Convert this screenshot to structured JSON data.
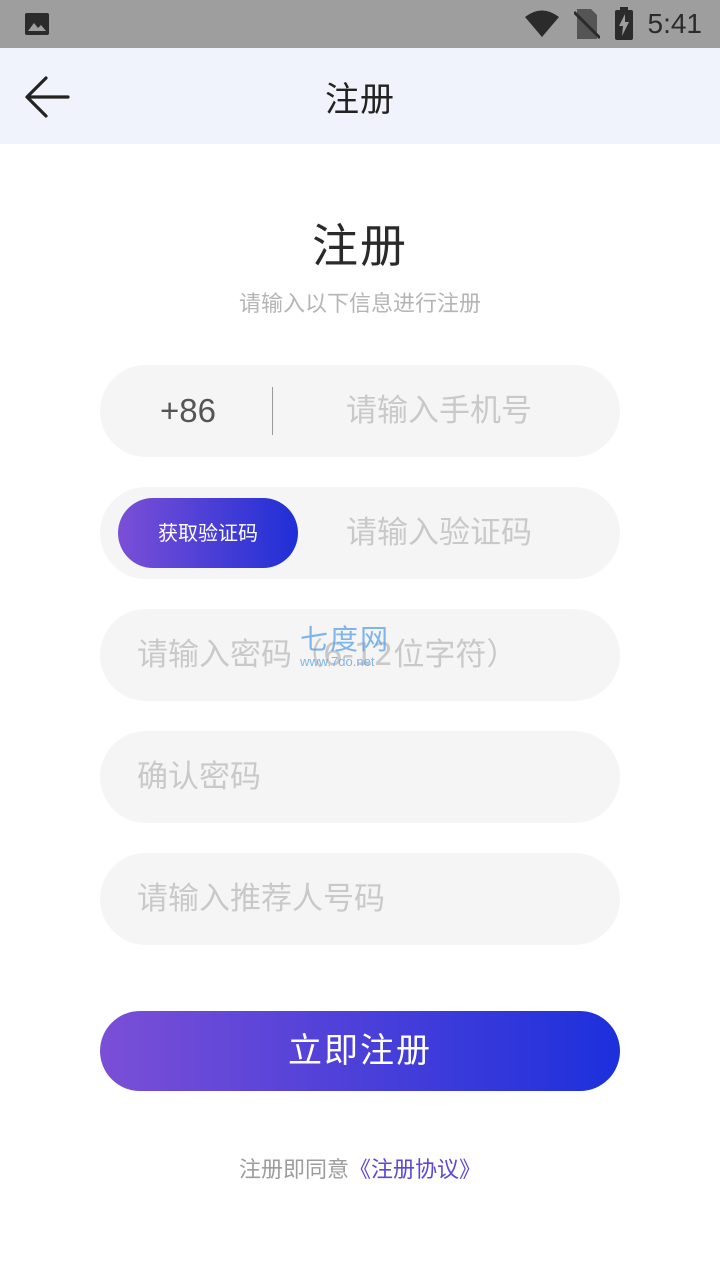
{
  "status_bar": {
    "time": "5:41",
    "icons": [
      "image-icon",
      "wifi-icon",
      "no-sim-icon",
      "battery-charging-icon"
    ]
  },
  "app_bar": {
    "title": "注册",
    "back_icon": "arrow-left-icon"
  },
  "header": {
    "title": "注册",
    "subtitle": "请输入以下信息进行注册"
  },
  "form": {
    "phone": {
      "prefix": "+86",
      "placeholder": "请输入手机号"
    },
    "code": {
      "button_label": "获取验证码",
      "placeholder": "请输入验证码"
    },
    "password": {
      "placeholder": "请输入密码（6-12位字符）"
    },
    "confirm_password": {
      "placeholder": "确认密码"
    },
    "referrer": {
      "placeholder": "请输入推荐人号码"
    }
  },
  "watermark": {
    "title": "七度网",
    "url": "www.7do.net"
  },
  "submit": {
    "label": "立即注册"
  },
  "agreement": {
    "text": "注册即同意",
    "link": "《注册协议》"
  },
  "colors": {
    "gradient_start": "#7b4fd6",
    "gradient_end": "#1c30dc",
    "link": "#5b48d8",
    "field_bg": "#f5f5f5",
    "appbar_bg": "#f0f3fb"
  }
}
